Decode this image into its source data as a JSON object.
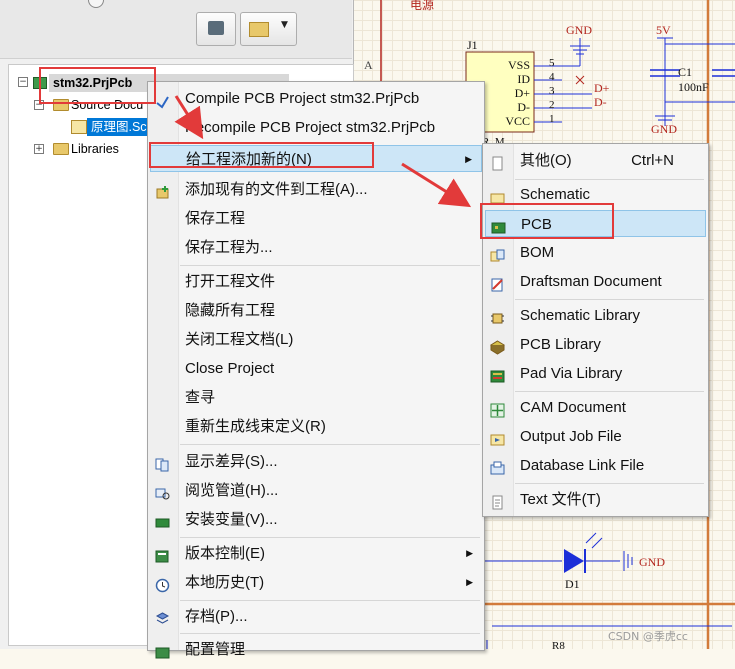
{
  "tree": {
    "project": "stm32.PrjPcb",
    "source_docs": "Source Docu",
    "schematic_doc": "原理图.Sc",
    "libraries": "Libraries"
  },
  "menu1": {
    "items": [
      {
        "label": "Compile PCB Project stm32.PrjPcb"
      },
      {
        "label": "Recompile PCB Project stm32.PrjPcb"
      },
      {
        "label": "给工程添加新的(N)",
        "submenu": true,
        "highlighted": true
      },
      {
        "label": "添加现有的文件到工程(A)..."
      },
      {
        "label": "保存工程"
      },
      {
        "label": "保存工程为..."
      },
      {
        "label": "打开工程文件"
      },
      {
        "label": "隐藏所有工程"
      },
      {
        "label": "关闭工程文档(L)"
      },
      {
        "label": "Close Project"
      },
      {
        "label": "查寻"
      },
      {
        "label": "重新生成线束定义(R)"
      },
      {
        "label": "显示差异(S)..."
      },
      {
        "label": "阅览管道(H)..."
      },
      {
        "label": "安装变量(V)..."
      },
      {
        "label": "版本控制(E)",
        "submenu": true
      },
      {
        "label": "本地历史(T)",
        "submenu": true
      },
      {
        "label": "存档(P)..."
      },
      {
        "label": "配置管理"
      }
    ]
  },
  "menu2": {
    "items": [
      {
        "label": "其他(O)",
        "shortcut": "Ctrl+N"
      },
      {
        "label": "Schematic"
      },
      {
        "label": "PCB",
        "highlighted": true
      },
      {
        "label": "BOM"
      },
      {
        "label": "Draftsman Document"
      },
      {
        "label": "Schematic Library"
      },
      {
        "label": "PCB Library"
      },
      {
        "label": "Pad Via Library"
      },
      {
        "label": "CAM Document"
      },
      {
        "label": "Output Job File"
      },
      {
        "label": "Database Link File"
      },
      {
        "label": "Text  文件(T)"
      }
    ]
  },
  "schematic": {
    "power_label": "电源",
    "row_label": "A",
    "ic_ref": "J1",
    "pins": [
      "VSS",
      "ID",
      "D+",
      "D-",
      "VCC"
    ],
    "pin_numbers": [
      "5",
      "4",
      "3",
      "2",
      "1"
    ],
    "gnd1": "GND",
    "net_dp": "D+",
    "net_dm": "D-",
    "fivev": "5V",
    "cap_ref": "C1",
    "cap_val": "100nF",
    "gnd2": "GND",
    "led_ref": "D1",
    "gnd3": "GND",
    "r_ref": "R8",
    "bus_text": "R_M",
    "watermark": "CSDN @季虎cc"
  },
  "colors": {
    "annotation": "#e23a3a",
    "selection": "#0078d7",
    "menu_highlight": "#cde6f7",
    "schematic_red": "#b3261e",
    "schematic_blue": "#1c2fd8"
  }
}
